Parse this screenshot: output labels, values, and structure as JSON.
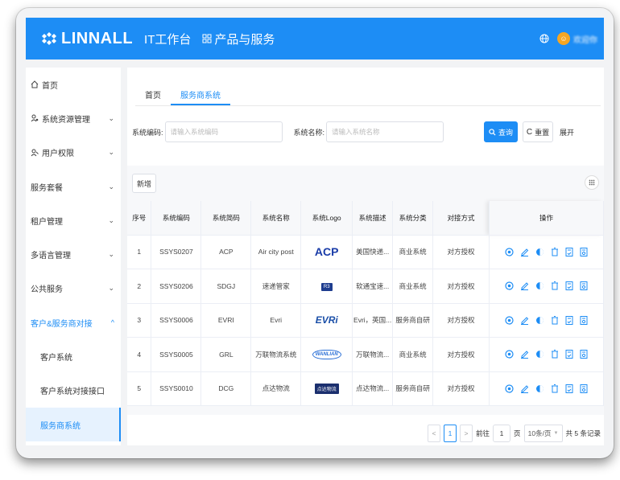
{
  "topbar": {
    "brand": "LINNALL",
    "nav_it": "IT工作台",
    "nav_products": "产品与服务",
    "greeting": "欢迎你"
  },
  "sidebar": {
    "items": [
      {
        "label": "首页",
        "icon": "home-icon"
      },
      {
        "label": "系统资源管理",
        "icon": "user-gear-icon",
        "chevron": "⌄"
      },
      {
        "label": "用户权限",
        "icon": "user-key-icon",
        "chevron": "⌄"
      },
      {
        "label": "服务套餐",
        "chevron": "⌄"
      },
      {
        "label": "租户管理",
        "chevron": "⌄"
      },
      {
        "label": "多语言管理",
        "chevron": "⌄"
      },
      {
        "label": "公共服务",
        "chevron": "⌄"
      },
      {
        "label": "客户&服务商对接",
        "chevron": "^"
      }
    ],
    "sub_items": [
      {
        "label": "客户系统"
      },
      {
        "label": "客户系统对接接口"
      },
      {
        "label": "服务商系统"
      }
    ]
  },
  "tabs": [
    {
      "label": "首页"
    },
    {
      "label": "服务商系统"
    }
  ],
  "filters": {
    "code_label": "系统编码:",
    "code_placeholder": "请输入系统编码",
    "name_label": "系统名称:",
    "name_placeholder": "请输入系统名称",
    "search_btn": "查询",
    "reset_btn": "重置",
    "expand": "展开"
  },
  "toolbar": {
    "add_btn": "新增"
  },
  "table": {
    "headers": [
      "序号",
      "系统编码",
      "系统简码",
      "系统名称",
      "系统Logo",
      "系统描述",
      "系统分类",
      "对接方式",
      "操作"
    ],
    "rows": [
      {
        "no": "1",
        "code": "SSYS0207",
        "short": "ACP",
        "name": "Air city post",
        "logo": "ACP",
        "desc": "美国快递...",
        "cat": "商业系统",
        "mode": "对方授权"
      },
      {
        "no": "2",
        "code": "SSYS0206",
        "short": "SDGJ",
        "name": "速递管家",
        "logo": "R3",
        "desc": "软通宝速...",
        "cat": "商业系统",
        "mode": "对方授权"
      },
      {
        "no": "3",
        "code": "SSYS0006",
        "short": "EVRI",
        "name": "Evri",
        "logo": "EVRi",
        "desc": "Evri，英国...",
        "cat": "服务商自研",
        "mode": "对方授权"
      },
      {
        "no": "4",
        "code": "SSYS0005",
        "short": "GRL",
        "name": "万联物流系统",
        "logo": "WANLIAN",
        "desc": "万联物流...",
        "cat": "商业系统",
        "mode": "对方授权"
      },
      {
        "no": "5",
        "code": "SSYS0010",
        "short": "DCG",
        "name": "点达物流",
        "logo": "点达物流",
        "desc": "点达物流...",
        "cat": "服务商自研",
        "mode": "对方授权"
      }
    ]
  },
  "pager": {
    "prev": "<",
    "current": "1",
    "next": ">",
    "goto_label": "前往",
    "goto_value": "1",
    "page_unit": "页",
    "size": "10条/页",
    "total": "共 5 条记录"
  }
}
